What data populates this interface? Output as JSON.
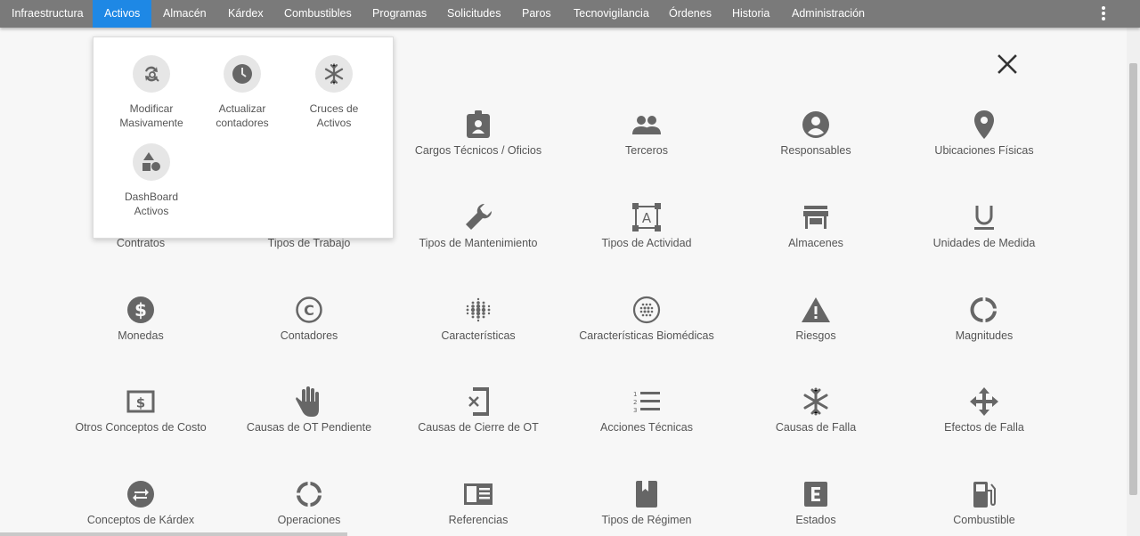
{
  "nav": {
    "items": [
      {
        "label": "Infraestructura"
      },
      {
        "label": "Activos",
        "active": true
      },
      {
        "label": "Almacén"
      },
      {
        "label": "Kárdex"
      },
      {
        "label": "Combustibles"
      },
      {
        "label": "Programas"
      },
      {
        "label": "Solicitudes"
      },
      {
        "label": "Paros"
      },
      {
        "label": "Tecnovigilancia"
      },
      {
        "label": "Órdenes"
      },
      {
        "label": "Historia"
      },
      {
        "label": "Administración"
      }
    ],
    "menu_icon": "more-vert-icon",
    "active_color": "#1e88e5",
    "bar_color": "#7a7a7a"
  },
  "popup": {
    "items": [
      {
        "label_line1": "Modificar",
        "label_line2": "Masivamente",
        "icon": "swap-search-icon"
      },
      {
        "label_line1": "Actualizar",
        "label_line2": "contadores",
        "icon": "clock-icon"
      },
      {
        "label_line1": "Cruces de",
        "label_line2": "Activos",
        "icon": "snowflake-icon"
      },
      {
        "label_line1": "DashBoard",
        "label_line2": "Activos",
        "icon": "shapes-icon"
      }
    ]
  },
  "close_icon": "close-icon",
  "grid": {
    "items": [
      {
        "label": "Cargos Técnicos / Oficios",
        "icon": "badge-icon"
      },
      {
        "label": "Terceros",
        "icon": "people-icon"
      },
      {
        "label": "Responsables",
        "icon": "account-circle-icon"
      },
      {
        "label": "Ubicaciones Físicas",
        "icon": "location-pin-icon"
      },
      {
        "label": "Contratos",
        "icon": "contract-icon"
      },
      {
        "label": "Tipos de Trabajo",
        "icon": "work-icon"
      },
      {
        "label": "Tipos de Mantenimiento",
        "icon": "wrench-icon"
      },
      {
        "label": "Tipos de Actividad",
        "icon": "text-frame-icon"
      },
      {
        "label": "Almacenes",
        "icon": "store-icon"
      },
      {
        "label": "Unidades de Medida",
        "icon": "underline-icon"
      },
      {
        "label": "Monedas",
        "icon": "dollar-circle-icon"
      },
      {
        "label": "Contadores",
        "icon": "copyright-icon"
      },
      {
        "label": "Características",
        "icon": "dots-grid-icon"
      },
      {
        "label": "Características Biomédicas",
        "icon": "dots-circle-icon"
      },
      {
        "label": "Riesgos",
        "icon": "warning-icon"
      },
      {
        "label": "Magnitudes",
        "icon": "donut-icon"
      },
      {
        "label": "Otros Conceptos de Costo",
        "icon": "money-icon"
      },
      {
        "label": "Causas de OT Pendiente",
        "icon": "hand-icon"
      },
      {
        "label": "Causas de Cierre de OT",
        "icon": "close-document-icon"
      },
      {
        "label": "Acciones Técnicas",
        "icon": "numbered-list-icon"
      },
      {
        "label": "Causas de Falla",
        "icon": "snowflake-icon"
      },
      {
        "label": "Efectos de Falla",
        "icon": "move-arrows-icon"
      },
      {
        "label": "Conceptos de Kárdex",
        "icon": "swap-circle-icon"
      },
      {
        "label": "Operaciones",
        "icon": "ring-icon"
      },
      {
        "label": "Referencias",
        "icon": "chrome-reader-icon"
      },
      {
        "label": "Tipos de Régimen",
        "icon": "book-icon"
      },
      {
        "label": "Estados",
        "icon": "letter-e-icon"
      },
      {
        "label": "Combustible",
        "icon": "fuel-icon"
      }
    ]
  }
}
